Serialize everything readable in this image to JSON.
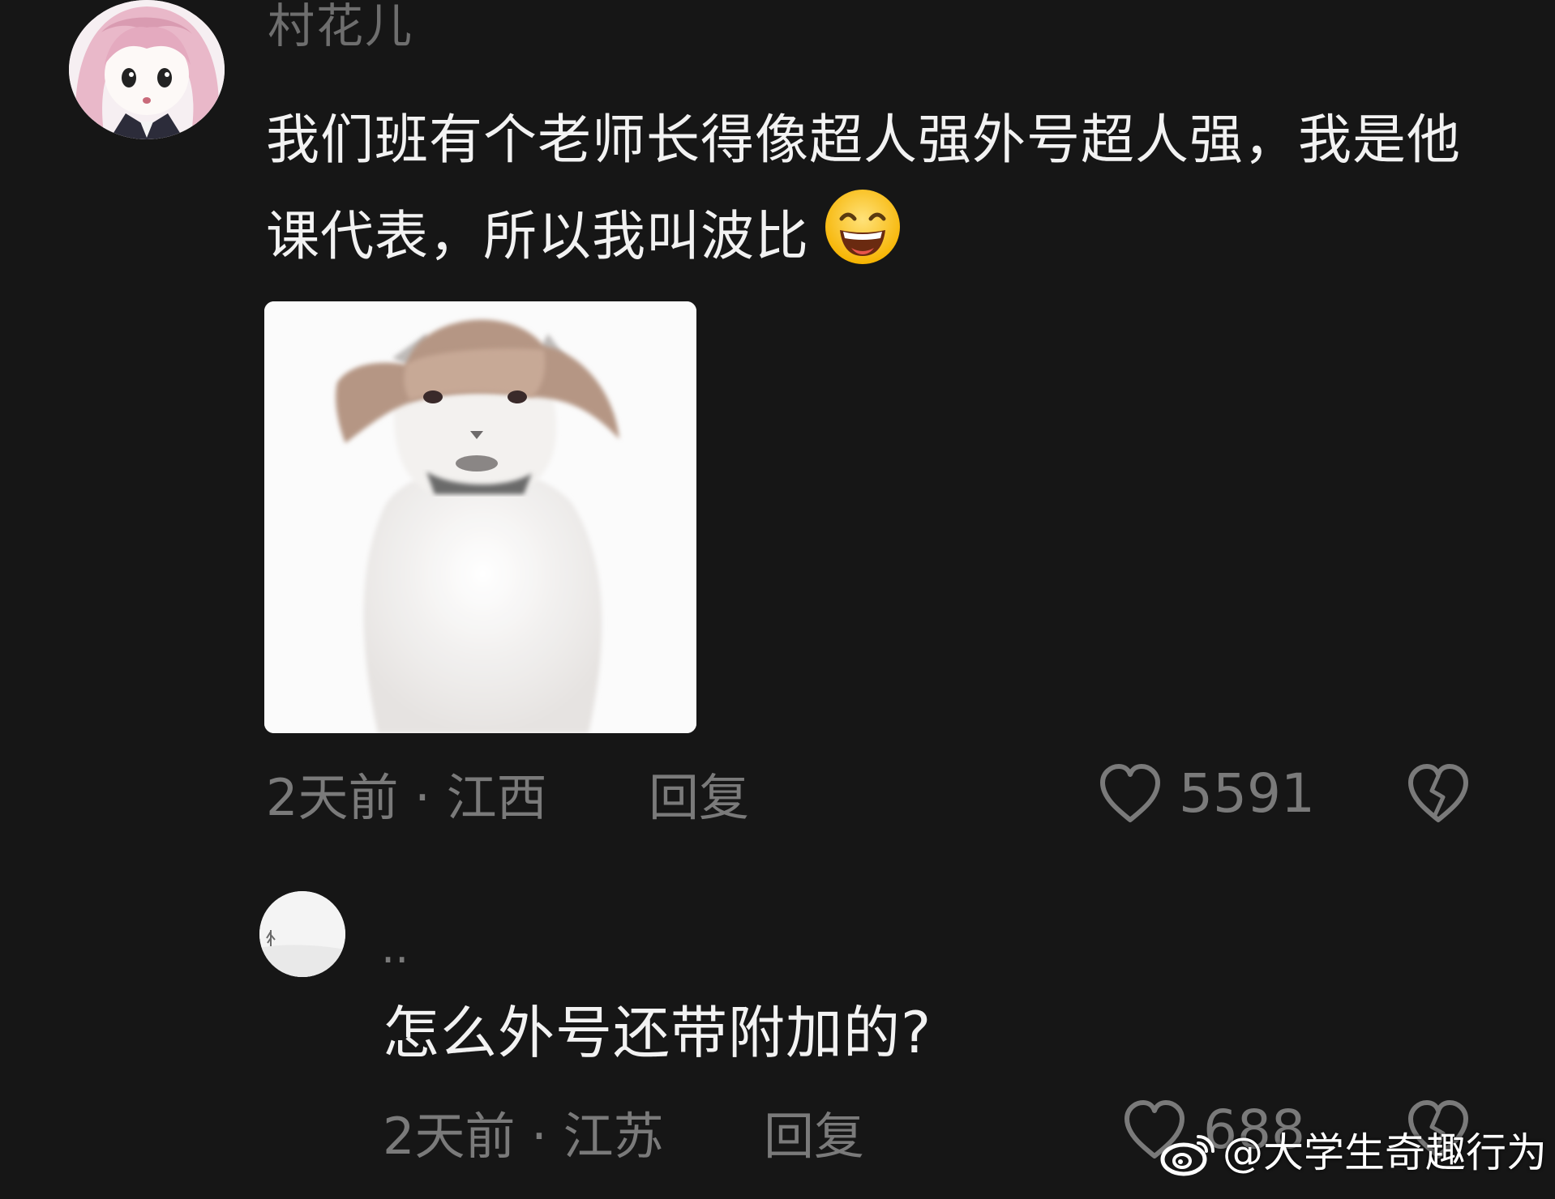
{
  "comment": {
    "username": "村花儿",
    "text": "我们班有个老师长得像超人强外号超人强，我是他课代表，所以我叫波比",
    "emoji": "grin-emoji",
    "attachment": "cat-with-hat-image",
    "time": "2天前",
    "separator": "·",
    "location": "江西",
    "reply_label": "回复",
    "likes": "5591"
  },
  "reply": {
    "username": "..",
    "text": "怎么外号还带附加的?",
    "time": "2天前",
    "separator": "·",
    "location": "江苏",
    "reply_label": "回复",
    "likes": "688"
  },
  "watermark": {
    "icon": "weibo-icon",
    "text": "@大学生奇趣行为"
  },
  "colors": {
    "background": "#161616",
    "primary_text": "#f2f2f2",
    "secondary_text": "#7a7a7a"
  }
}
